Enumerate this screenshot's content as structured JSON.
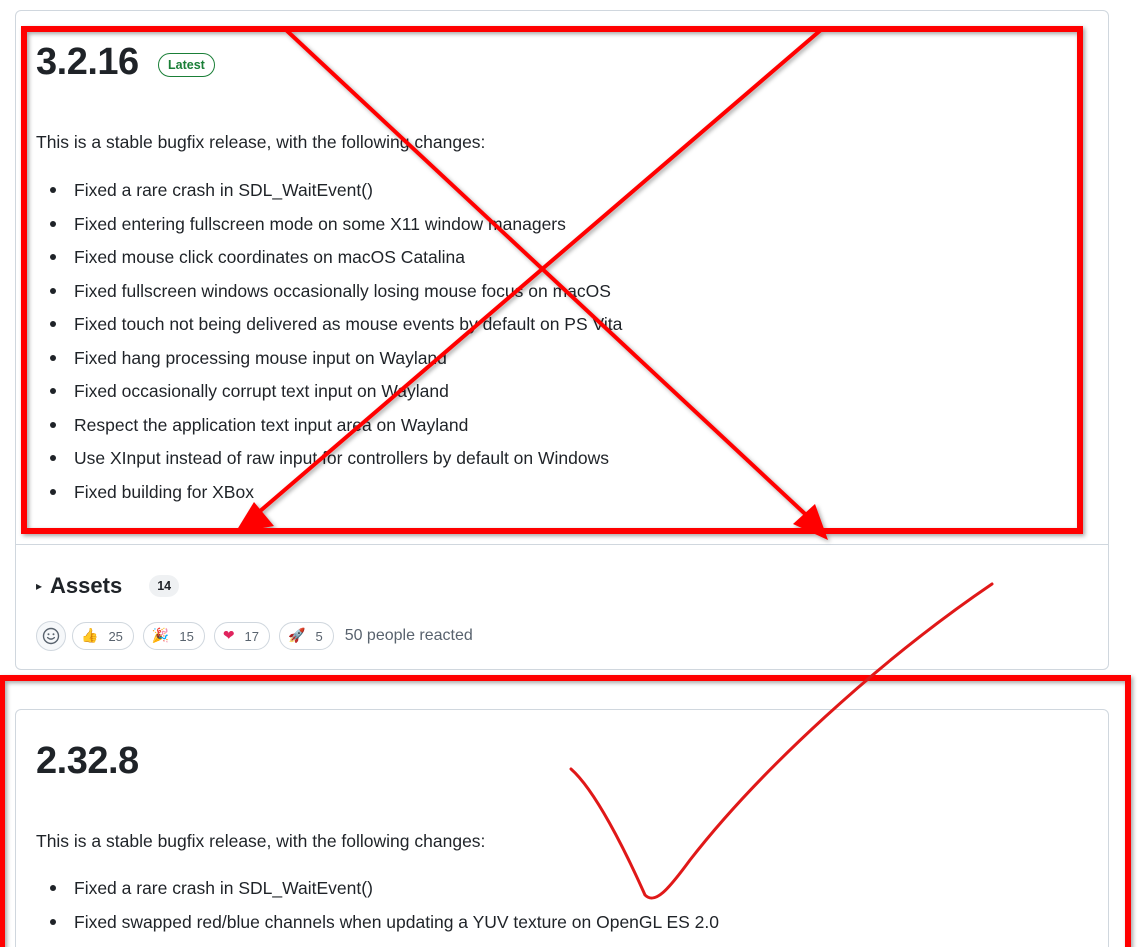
{
  "releases": [
    {
      "version": "3.2.16",
      "badge": "Latest",
      "intro": "This is a stable bugfix release, with the following changes:",
      "changes": [
        "Fixed a rare crash in SDL_WaitEvent()",
        "Fixed entering fullscreen mode on some X11 window managers",
        "Fixed mouse click coordinates on macOS Catalina",
        "Fixed fullscreen windows occasionally losing mouse focus on macOS",
        "Fixed touch not being delivered as mouse events by default on PS Vita",
        "Fixed hang processing mouse input on Wayland",
        "Fixed occasionally corrupt text input on Wayland",
        "Respect the application text input area on Wayland",
        "Use XInput instead of raw input for controllers by default on Windows",
        "Fixed building for XBox"
      ],
      "assets": {
        "caret": "▸",
        "label": "Assets",
        "count": "14"
      },
      "reactions": {
        "add_icon": "smiley-icon",
        "items": [
          {
            "emoji": "👍",
            "icon": "thumbs-up-icon",
            "count": "25"
          },
          {
            "emoji": "🎉",
            "icon": "party-popper-icon",
            "count": "15"
          },
          {
            "emoji": "❤",
            "icon": "heart-icon",
            "count": "17"
          },
          {
            "emoji": "🚀",
            "icon": "rocket-icon",
            "count": "5"
          }
        ],
        "summary": "50 people reacted"
      }
    },
    {
      "version": "2.32.8",
      "intro": "This is a stable bugfix release, with the following changes:",
      "changes": [
        "Fixed a rare crash in SDL_WaitEvent()",
        "Fixed swapped red/blue channels when updating a YUV texture on OpenGL ES 2.0"
      ]
    }
  ],
  "annotations": {
    "color": "#ff0000",
    "marks": [
      "crossed-out-box",
      "highlight-box",
      "checkmark"
    ]
  }
}
